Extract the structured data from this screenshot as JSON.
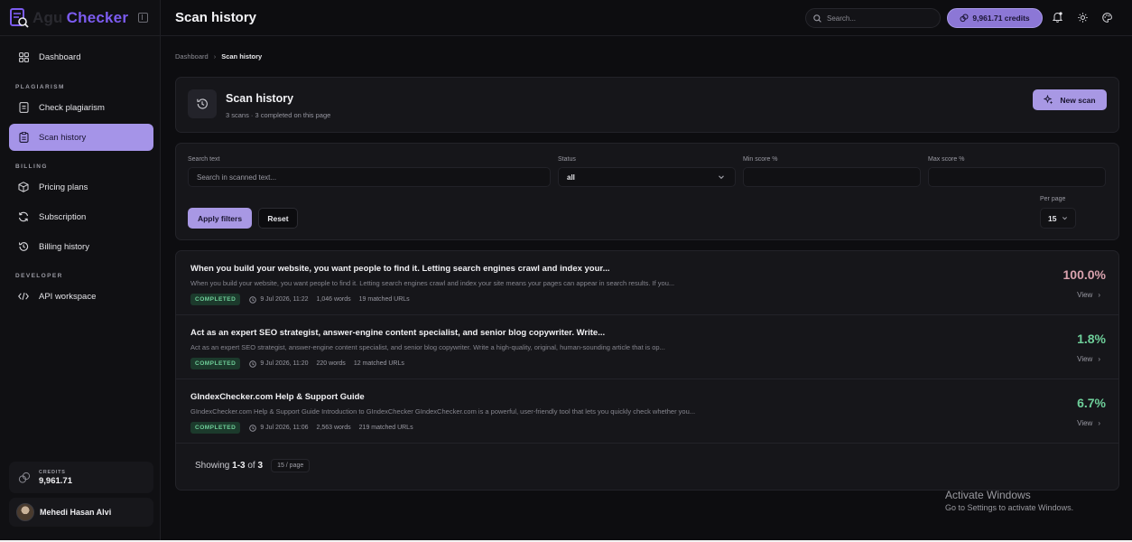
{
  "app": {
    "brand": "Checker",
    "brand_ghost": "Agu"
  },
  "topbar": {
    "title": "Scan history",
    "search_placeholder": "Search...",
    "credits": "9,961.71 credits"
  },
  "sidebar": {
    "items": [
      {
        "label": "Dashboard",
        "icon": "dashboard-icon"
      },
      {
        "label": "Check plagiarism",
        "icon": "document-icon"
      },
      {
        "label": "Scan history",
        "icon": "clipboard-icon",
        "active": true
      },
      {
        "label": "Pricing plans",
        "icon": "box-icon"
      },
      {
        "label": "Subscription",
        "icon": "refresh-icon"
      },
      {
        "label": "Billing history",
        "icon": "history-icon"
      },
      {
        "label": "API workspace",
        "icon": "code-icon"
      }
    ],
    "sections": {
      "plagiarism": "PLAGIARISM",
      "billing": "BILLING",
      "developer": "DEVELOPER"
    },
    "credits_label": "CREDITS",
    "credits_value": "9,961.71",
    "user_name": "Mehedi Hasan Alvi"
  },
  "breadcrumb": {
    "root": "Dashboard",
    "current": "Scan history"
  },
  "header": {
    "title": "Scan history",
    "subtitle": "3 scans · 3 completed on this page",
    "new_scan": "New scan"
  },
  "filters": {
    "search_label": "Search text",
    "search_placeholder": "Search in scanned text...",
    "status_label": "Status",
    "status_value": "all",
    "min_label": "Min score %",
    "max_label": "Max score %",
    "apply": "Apply filters",
    "reset": "Reset",
    "per_page_label": "Per page",
    "per_page_value": "15"
  },
  "results": [
    {
      "title": "When you build your website, you want people to find it. Letting search engines crawl and index your...",
      "snippet": "When you build your website, you want people to find it. Letting search engines crawl and index your site means your pages can appear in search results. If you...",
      "status": "COMPLETED",
      "date": "9 Jul 2026, 11:22",
      "words": "1,046 words",
      "matches": "19 matched URLs",
      "score": "100.0%",
      "score_color": "#d9a2ae",
      "view": "View"
    },
    {
      "title": "Act as an expert SEO strategist, answer-engine content specialist, and senior blog copywriter. Write...",
      "snippet": "Act as an expert SEO strategist, answer-engine content specialist, and senior blog copywriter. Write a high-quality, original, human-sounding article that is op...",
      "status": "COMPLETED",
      "date": "9 Jul 2026, 11:20",
      "words": "220 words",
      "matches": "12 matched URLs",
      "score": "1.8%",
      "score_color": "#6ecf9a",
      "view": "View"
    },
    {
      "title": "GIndexChecker.com Help & Support Guide",
      "snippet": "GIndexChecker.com Help & Support Guide Introduction to GIndexChecker GIndexChecker.com is a powerful, user-friendly tool that lets you quickly check whether you...",
      "status": "COMPLETED",
      "date": "9 Jul 2026, 11:06",
      "words": "2,563 words",
      "matches": "219 matched URLs",
      "score": "6.7%",
      "score_color": "#6ecf9a",
      "view": "View"
    }
  ],
  "pager": {
    "showing": "Showing",
    "range": "1-3",
    "of": "of",
    "total": "3",
    "per_page": "15 / page"
  },
  "windows": {
    "line1": "Activate Windows",
    "line2": "Go to Settings to activate Windows."
  }
}
